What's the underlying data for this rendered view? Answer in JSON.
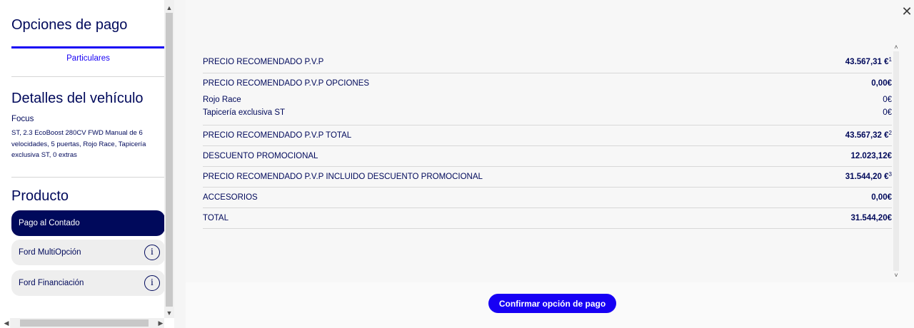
{
  "sidebar": {
    "title": "Opciones de pago",
    "tab_label": "Particulares",
    "vehicle_section_title": "Detalles del vehículo",
    "vehicle_name": "Focus",
    "vehicle_description": "ST, 2.3 EcoBoost 280CV FWD Manual de 6 velocidades, 5 puertas, Rojo Race, Tapicería exclusiva ST, 0 extras",
    "product_section_title": "Producto",
    "products": [
      {
        "label": "Pago al Contado",
        "active": true,
        "icon": ""
      },
      {
        "label": "Ford MultiOpción",
        "active": false,
        "icon": "info-icon"
      },
      {
        "label": "Ford Financiación",
        "active": false,
        "icon": "info-icon"
      }
    ],
    "info_glyph": "i"
  },
  "close_glyph": "✕",
  "price_rows": {
    "pvp": {
      "label": "PRECIO RECOMENDADO P.V.P",
      "value": "43.567,31 €",
      "note": "1"
    },
    "pvp_options": {
      "label": "PRECIO RECOMENDADO P.V.P OPCIONES",
      "value": "0,00€"
    },
    "option_1": {
      "label": "Rojo Race",
      "value": "0€"
    },
    "option_2": {
      "label": "Tapicería exclusiva ST",
      "value": "0€"
    },
    "pvp_total": {
      "label": "PRECIO RECOMENDADO P.V.P TOTAL",
      "value": "43.567,32 €",
      "note": "2"
    },
    "discount": {
      "label": "DESCUENTO PROMOCIONAL",
      "value": "12.023,12€"
    },
    "pvp_with_discount": {
      "label": "PRECIO RECOMENDADO P.V.P INCLUIDO DESCUENTO PROMOCIONAL",
      "value": "31.544,20 €",
      "note": "3"
    },
    "accessories": {
      "label": "ACCESORIOS",
      "value": "0,00€"
    },
    "total": {
      "label": "TOTAL",
      "value": "31.544,20€"
    }
  },
  "confirm_button": "Confirmar opción de pago",
  "colors": {
    "brand_navy": "#00095b",
    "accent_blue": "#1700f4"
  }
}
